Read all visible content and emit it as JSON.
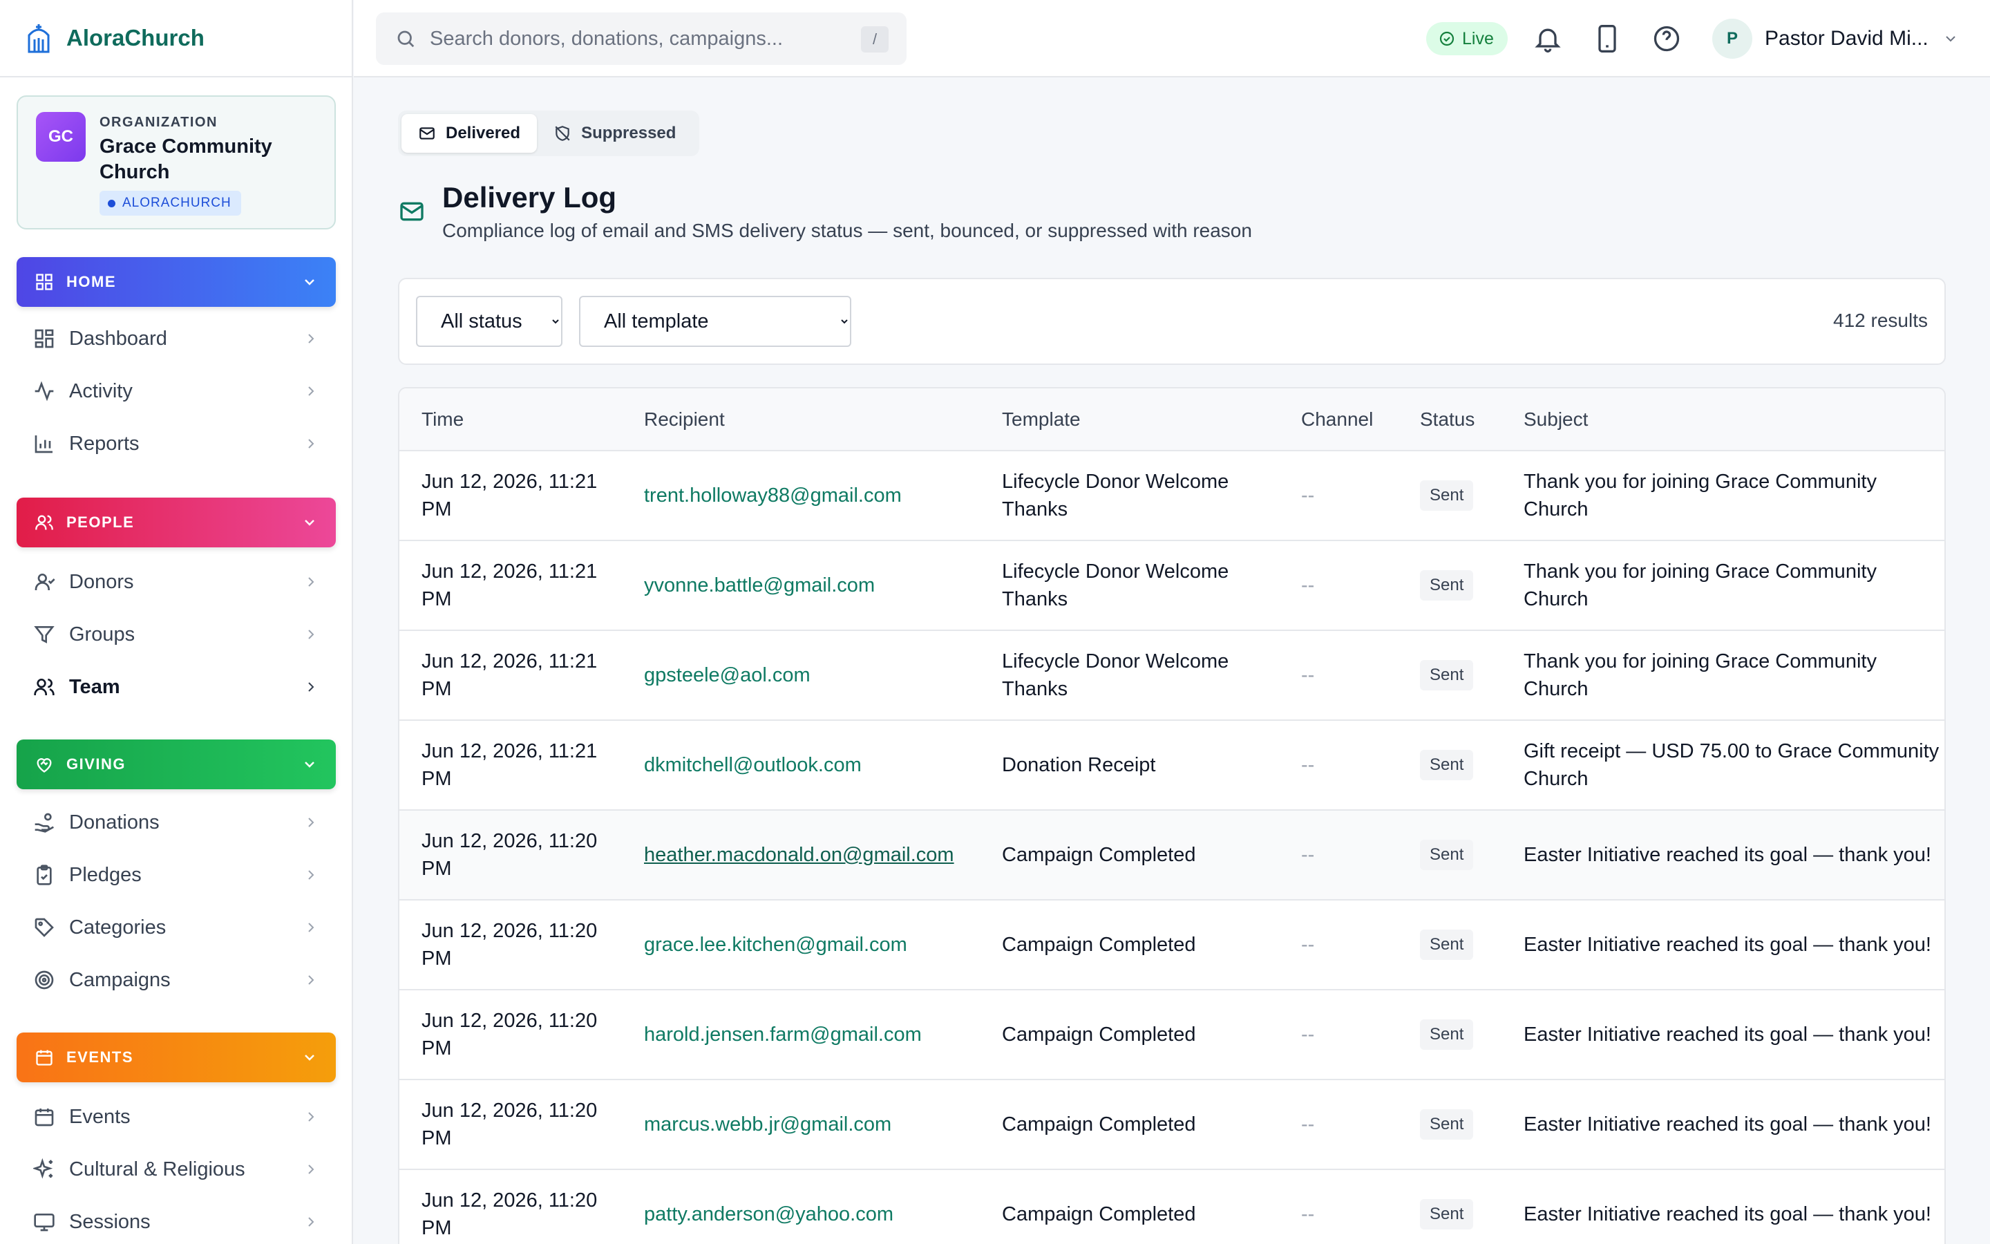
{
  "brand": {
    "name": "AloraChurch"
  },
  "organization": {
    "kicker": "ORGANIZATION",
    "name": "Grace Community Church",
    "initials": "GC",
    "tag": "ALORACHURCH",
    "avatar_color": "#8b5cf6"
  },
  "sidebar": {
    "sections": [
      {
        "label": "HOME",
        "color": "#4f46e5",
        "items": [
          {
            "label": "Dashboard",
            "icon": "dashboard-icon"
          },
          {
            "label": "Activity",
            "icon": "activity-icon"
          },
          {
            "label": "Reports",
            "icon": "bar-chart-icon"
          }
        ]
      },
      {
        "label": "PEOPLE",
        "color": "#e11d48",
        "items": [
          {
            "label": "Donors",
            "icon": "user-icon"
          },
          {
            "label": "Groups",
            "icon": "filter-icon"
          },
          {
            "label": "Team",
            "icon": "users-icon",
            "active": true
          }
        ]
      },
      {
        "label": "GIVING",
        "color": "#16a34a",
        "items": [
          {
            "label": "Donations",
            "icon": "hand-coins-icon"
          },
          {
            "label": "Pledges",
            "icon": "clipboard-check-icon"
          },
          {
            "label": "Categories",
            "icon": "tag-icon"
          },
          {
            "label": "Campaigns",
            "icon": "target-icon"
          }
        ]
      },
      {
        "label": "EVENTS",
        "color": "#f97316",
        "items": [
          {
            "label": "Events",
            "icon": "calendar-icon"
          },
          {
            "label": "Cultural & Religious",
            "icon": "sparkles-icon"
          },
          {
            "label": "Sessions",
            "icon": "monitor-icon"
          }
        ]
      }
    ]
  },
  "topbar": {
    "search_placeholder": "Search donors, donations, campaigns...",
    "search_shortcut": "/",
    "live_label": "Live",
    "user_initial": "P",
    "user_name": "Pastor David Mi..."
  },
  "tabs": [
    {
      "label": "Delivered",
      "icon": "mail-icon",
      "active": true
    },
    {
      "label": "Suppressed",
      "icon": "shield-off-icon",
      "active": false
    }
  ],
  "page": {
    "title": "Delivery Log",
    "subtitle": "Compliance log of email and SMS delivery status — sent, bounced, or suppressed with reason"
  },
  "filters": {
    "status_options": [
      "All status"
    ],
    "status_value": "All status",
    "template_options": [
      "All template"
    ],
    "template_value": "All template",
    "results": "412 results"
  },
  "table": {
    "columns": [
      "Time",
      "Recipient",
      "Template",
      "Channel",
      "Status",
      "Subject"
    ],
    "rows": [
      {
        "time": "Jun 12, 2026, 11:21 PM",
        "recipient": "trent.holloway88@gmail.com",
        "template": "Lifecycle Donor Welcome Thanks",
        "channel": "--",
        "status": "Sent",
        "subject": "Thank you for joining Grace Community Church"
      },
      {
        "time": "Jun 12, 2026, 11:21 PM",
        "recipient": "yvonne.battle@gmail.com",
        "template": "Lifecycle Donor Welcome Thanks",
        "channel": "--",
        "status": "Sent",
        "subject": "Thank you for joining Grace Community Church"
      },
      {
        "time": "Jun 12, 2026, 11:21 PM",
        "recipient": "gpsteele@aol.com",
        "template": "Lifecycle Donor Welcome Thanks",
        "channel": "--",
        "status": "Sent",
        "subject": "Thank you for joining Grace Community Church"
      },
      {
        "time": "Jun 12, 2026, 11:21 PM",
        "recipient": "dkmitchell@outlook.com",
        "template": "Donation Receipt",
        "channel": "--",
        "status": "Sent",
        "subject": "Gift receipt — USD 75.00 to Grace Community Church"
      },
      {
        "time": "Jun 12, 2026, 11:20 PM",
        "recipient": "heather.macdonald.on@gmail.com",
        "template": "Campaign Completed",
        "channel": "--",
        "status": "Sent",
        "subject": "Easter Initiative reached its goal — thank you!",
        "hover": true
      },
      {
        "time": "Jun 12, 2026, 11:20 PM",
        "recipient": "grace.lee.kitchen@gmail.com",
        "template": "Campaign Completed",
        "channel": "--",
        "status": "Sent",
        "subject": "Easter Initiative reached its goal — thank you!"
      },
      {
        "time": "Jun 12, 2026, 11:20 PM",
        "recipient": "harold.jensen.farm@gmail.com",
        "template": "Campaign Completed",
        "channel": "--",
        "status": "Sent",
        "subject": "Easter Initiative reached its goal — thank you!"
      },
      {
        "time": "Jun 12, 2026, 11:20 PM",
        "recipient": "marcus.webb.jr@gmail.com",
        "template": "Campaign Completed",
        "channel": "--",
        "status": "Sent",
        "subject": "Easter Initiative reached its goal — thank you!"
      },
      {
        "time": "Jun 12, 2026, 11:20 PM",
        "recipient": "patty.anderson@yahoo.com",
        "template": "Campaign Completed",
        "channel": "--",
        "status": "Sent",
        "subject": "Easter Initiative reached its goal — thank you!"
      }
    ]
  }
}
